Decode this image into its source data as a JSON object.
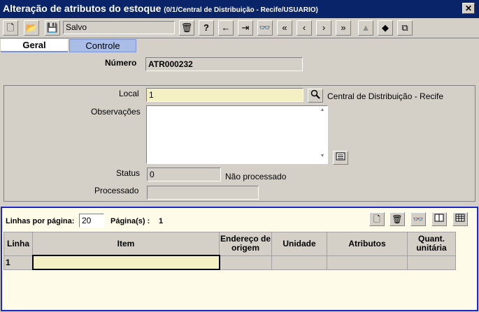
{
  "window": {
    "title": "Alteração de atributos do estoque",
    "subtitle": "(0/1/Central de Distribuição - Recife/USUARIO)",
    "close_glyph": "✕"
  },
  "toolbar": {
    "status_value": "Salvo",
    "buttons": [
      {
        "name": "new-document-icon",
        "glyph": "🗋"
      },
      {
        "name": "open-folder-icon",
        "glyph": "📂"
      },
      {
        "name": "save-disk-icon",
        "glyph": "💾"
      },
      {
        "name": "delete-trash-icon",
        "glyph": "🗑"
      },
      {
        "name": "help-icon",
        "glyph": "?"
      },
      {
        "name": "back-arrow-icon",
        "glyph": "←"
      },
      {
        "name": "exit-icon",
        "glyph": "⇥"
      },
      {
        "name": "search-binoculars-icon",
        "glyph": "👓"
      },
      {
        "name": "first-record-icon",
        "glyph": "«"
      },
      {
        "name": "previous-record-icon",
        "glyph": "‹"
      },
      {
        "name": "next-record-icon",
        "glyph": "›"
      },
      {
        "name": "last-record-icon",
        "glyph": "»"
      },
      {
        "name": "road-icon",
        "glyph": "▲"
      },
      {
        "name": "eraser-icon",
        "glyph": "◆"
      },
      {
        "name": "copy-icon",
        "glyph": "⧉"
      }
    ]
  },
  "tabs": {
    "geral": "Geral",
    "controle": "Controle"
  },
  "header": {
    "numero_label": "Número",
    "numero_value": "ATR000232"
  },
  "form": {
    "local_label": "Local",
    "local_value": "1",
    "local_description": "Central de Distribuição -  Recife",
    "observacoes_label": "Observações",
    "observacoes_value": "",
    "status_label": "Status",
    "status_value": "0",
    "status_description": "Não processado",
    "processado_label": "Processado",
    "processado_value": ""
  },
  "grid": {
    "lines_per_page_label": "Linhas por página:",
    "lines_per_page_value": "20",
    "pages_label": "Página(s) :",
    "pages_value": "1",
    "columns": {
      "linha": "Linha",
      "item": "Item",
      "endereco": "Endereço de origem",
      "unidade": "Unidade",
      "atributos": "Atributos",
      "quant": "Quant. unitária"
    },
    "rows": [
      {
        "linha": "1",
        "item": "",
        "endereco": "",
        "unidade": "",
        "atributos": "",
        "quant": ""
      }
    ]
  }
}
